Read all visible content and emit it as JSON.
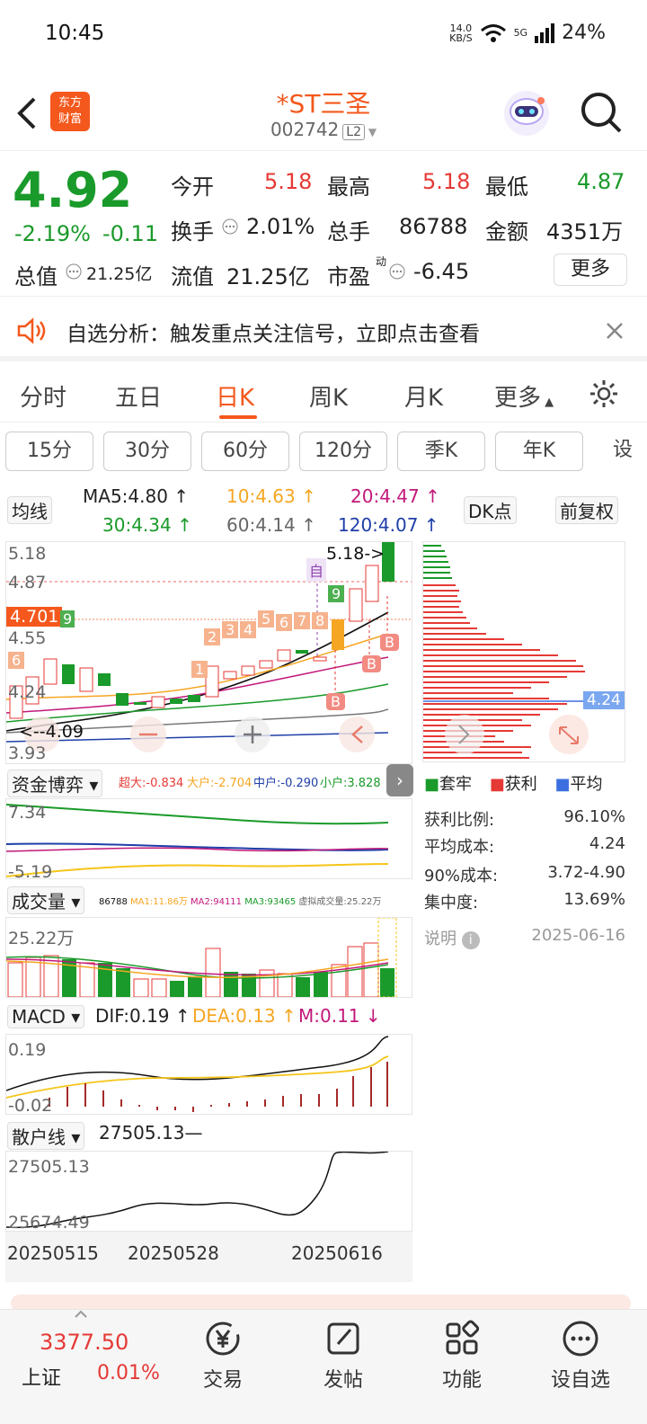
{
  "status": {
    "time": "10:45",
    "net_speed_top": "14.0",
    "net_speed_unit": "KB/S",
    "signal": "5G",
    "battery": "24%"
  },
  "header": {
    "title": "*ST三圣",
    "code": "002742",
    "level": "L2",
    "logo_line1": "东方",
    "logo_line2": "财富"
  },
  "quote": {
    "price": "4.92",
    "change_pct": "-2.19%",
    "change": "-0.11",
    "open_label": "今开",
    "open": "5.18",
    "high_label": "最高",
    "high": "5.18",
    "low_label": "最低",
    "low": "4.87",
    "turnover_label": "换手",
    "turnover": "2.01%",
    "volume_label": "总手",
    "volume": "86788",
    "amount_label": "金额",
    "amount": "4351万",
    "mcap_label": "总值",
    "mcap": "21.25亿",
    "float_label": "流值",
    "float": "21.25亿",
    "pe_label": "市盈",
    "pe_sup": "动",
    "pe": "-6.45",
    "more": "更多"
  },
  "alert": {
    "text": "自选分析：触发重点关注信号，立即点击查看"
  },
  "tabs": [
    {
      "label": "分时"
    },
    {
      "label": "五日"
    },
    {
      "label": "日K"
    },
    {
      "label": "周K"
    },
    {
      "label": "月K"
    },
    {
      "label": "更多"
    }
  ],
  "periods": [
    {
      "label": "15分"
    },
    {
      "label": "30分"
    },
    {
      "label": "60分"
    },
    {
      "label": "120分"
    },
    {
      "label": "季K"
    },
    {
      "label": "年K"
    },
    {
      "label": "设"
    }
  ],
  "ma": {
    "sel": "均线",
    "ma5": "MA5:4.80",
    "ma10": "10:4.63",
    "ma20": "20:4.47",
    "ma30": "30:4.34",
    "ma60": "60:4.14",
    "ma120": "120:4.07",
    "dk": "DK点",
    "fq": "前复权"
  },
  "kline": {
    "y_top": "5.18",
    "y_2": "4.87",
    "y_cur": "4.701",
    "y_3": "4.55",
    "y_4": "4.24",
    "y_bot": "3.93",
    "high_tag": "5.18",
    "low_tag": "4.09",
    "cost_tag": "4.24",
    "self_tag": "自",
    "marks": [
      "1",
      "2",
      "3",
      "4",
      "5",
      "6",
      "7",
      "8",
      "9",
      "6",
      "9"
    ],
    "signal": "B"
  },
  "chip": {
    "legend": [
      {
        "name": "套牢"
      },
      {
        "name": "获利"
      },
      {
        "name": "平均"
      }
    ],
    "stats": [
      {
        "k": "获利比例:",
        "v": "96.10%"
      },
      {
        "k": "平均成本:",
        "v": "4.24"
      },
      {
        "k": "90%成本:",
        "v": "3.72-4.90"
      },
      {
        "k": "集中度:",
        "v": "13.69%"
      }
    ],
    "note": "说明",
    "date": "2025-06-16"
  },
  "fund": {
    "sel": "资金博弈",
    "big": "超大:-0.834",
    "large": "大户:-2.704",
    "mid": "中户:-0.290",
    "small": "小户:3.828",
    "y_top": "7.34",
    "y_bot": "-5.19"
  },
  "vol": {
    "sel": "成交量",
    "legend": "86788",
    "ma1": "MA1:11.86万",
    "ma2": "MA2:94111",
    "ma3": "MA3:93465",
    "virtual": "虚拟成交量:25.22万",
    "y_top": "25.22万"
  },
  "macd": {
    "sel": "MACD",
    "dif": "DIF:0.19",
    "dea": "DEA:0.13",
    "m": "M:0.11",
    "y_top": "0.19",
    "y_bot": "-0.02"
  },
  "retail": {
    "sel": "散户线",
    "val": "27505.13",
    "y_top": "27505.13",
    "y_bot": "25674.49"
  },
  "dates": [
    "20250515",
    "20250528",
    "20250616"
  ],
  "bottom": {
    "index_val": "3377.50",
    "index_name": "上证",
    "index_chg": "0.01%",
    "items": [
      {
        "label": "交易"
      },
      {
        "label": "发帖"
      },
      {
        "label": "功能"
      },
      {
        "label": "设自选"
      }
    ]
  }
}
